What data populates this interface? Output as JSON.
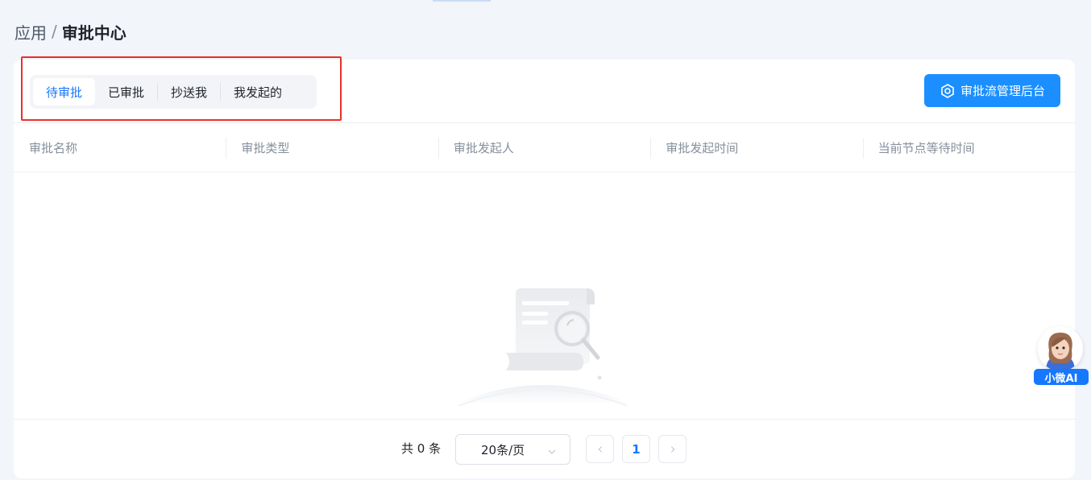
{
  "breadcrumb": {
    "parent": "应用",
    "separator": "/",
    "current": "审批中心"
  },
  "tabs": [
    {
      "label": "待审批",
      "active": true
    },
    {
      "label": "已审批",
      "active": false
    },
    {
      "label": "抄送我",
      "active": false
    },
    {
      "label": "我发起的",
      "active": false
    }
  ],
  "toolbar": {
    "admin_button_label": "审批流管理后台",
    "admin_button_icon": "hexagon-settings-icon"
  },
  "table": {
    "columns": [
      "审批名称",
      "审批类型",
      "审批发起人",
      "审批发起时间",
      "当前节点等待时间"
    ],
    "rows": []
  },
  "pagination": {
    "total_label": "共 0 条",
    "page_size": "20条/页",
    "current_page": "1"
  },
  "assistant": {
    "label": "小微AI"
  },
  "colors": {
    "accent": "#1677ff",
    "button": "#1b8fff",
    "highlight": "#e8302a",
    "background": "#f2f5fa"
  }
}
